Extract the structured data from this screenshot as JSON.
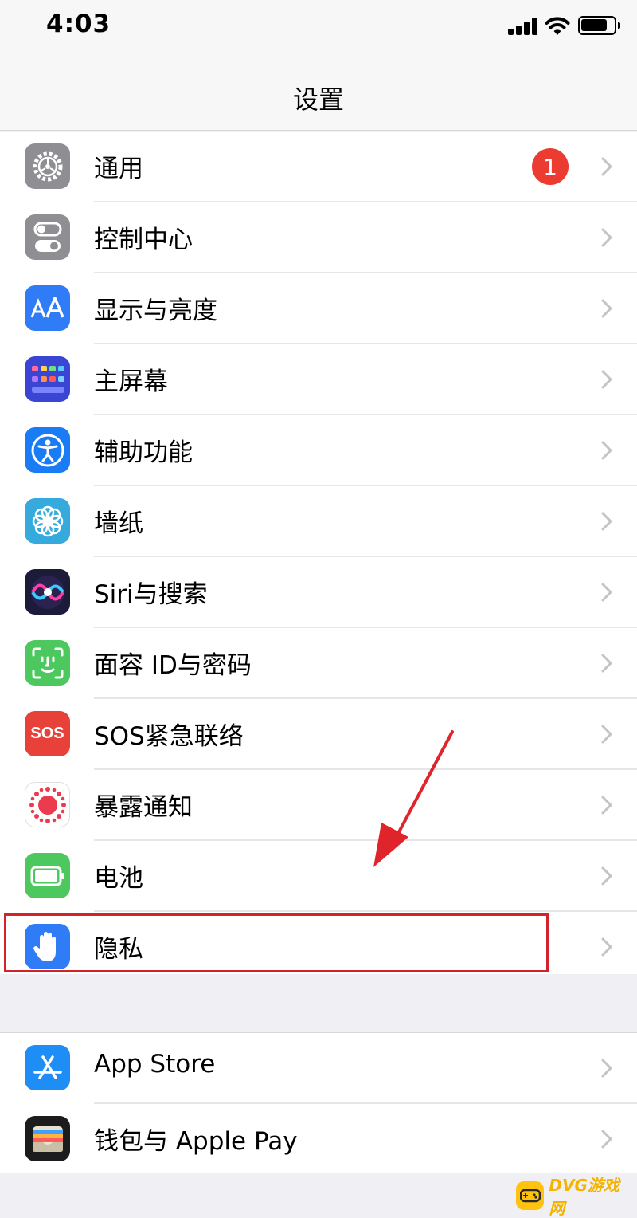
{
  "status": {
    "time": "4:03"
  },
  "nav": {
    "title": "设置"
  },
  "group1": [
    {
      "id": "general",
      "label": "通用",
      "icon": "gear-icon",
      "color": "#8e8e93",
      "badge": "1"
    },
    {
      "id": "control-center",
      "label": "控制中心",
      "icon": "toggles-icon",
      "color": "#8e8e93"
    },
    {
      "id": "display",
      "label": "显示与亮度",
      "icon": "text-size-icon",
      "color": "#2f7cf6"
    },
    {
      "id": "home-screen",
      "label": "主屏幕",
      "icon": "app-grid-icon",
      "color": "#3b45d4"
    },
    {
      "id": "accessibility",
      "label": "辅助功能",
      "icon": "accessibility-icon",
      "color": "#1a7cf5"
    },
    {
      "id": "wallpaper",
      "label": "墙纸",
      "icon": "flower-icon",
      "color": "#36aadc"
    },
    {
      "id": "siri",
      "label": "Siri与搜索",
      "icon": "siri-icon",
      "color": "#1c1c3a"
    },
    {
      "id": "face-id",
      "label": "面容 ID与密码",
      "icon": "face-id-icon",
      "color": "#4cc85e"
    },
    {
      "id": "sos",
      "label": "SOS紧急联络",
      "icon": "sos-icon",
      "color": "#e8413a",
      "icon_text": "SOS"
    },
    {
      "id": "exposure",
      "label": "暴露通知",
      "icon": "exposure-icon",
      "color": "#ffffff"
    },
    {
      "id": "battery",
      "label": "电池",
      "icon": "battery-icon",
      "color": "#4cc85e"
    },
    {
      "id": "privacy",
      "label": "隐私",
      "icon": "hand-icon",
      "color": "#2f7cf6"
    }
  ],
  "group2": [
    {
      "id": "app-store",
      "label": "App Store",
      "icon": "app-store-icon",
      "color": "#1e8ef6"
    },
    {
      "id": "wallet",
      "label": "钱包与 Apple Pay",
      "icon": "wallet-icon",
      "color": "#1c1c1e"
    }
  ],
  "annotation": {
    "highlight_color": "#d2232a",
    "highlighted_row": "privacy"
  },
  "watermark": {
    "text": "DVG游戏网"
  }
}
